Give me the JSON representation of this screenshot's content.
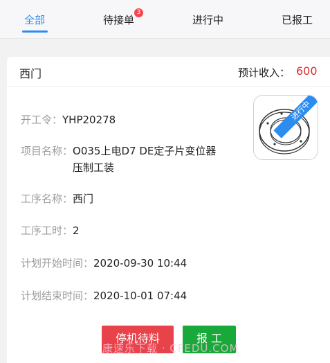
{
  "tabs": [
    {
      "label": "全部",
      "active": true
    },
    {
      "label": "待接单",
      "badge": "3"
    },
    {
      "label": "进行中"
    },
    {
      "label": "已报工"
    }
  ],
  "card": {
    "title": "西门",
    "income_label": "预计收入：",
    "income_value": "600",
    "status_ribbon": "进行中",
    "fields": [
      {
        "label": "开工令：",
        "value": "YHP20278"
      },
      {
        "label": "项目名称：",
        "value_line1": "O035上电D7 DE定子片变位器",
        "value_line2": "压制工装"
      },
      {
        "label": "工序名称：",
        "value": "西门"
      },
      {
        "label": "工序工时：",
        "value": "2"
      },
      {
        "label": "计划开始时间：",
        "value": "2020-09-30 10:44"
      },
      {
        "label": "计划结束时间：",
        "value": "2020-10-01 07:44"
      }
    ],
    "buttons": {
      "stop": "停机待料",
      "report": "报 工"
    }
  },
  "watermark": "康速乐下载 · CFEDU.COM",
  "colors": {
    "accent": "#2d8cf0",
    "price": "#e12b2b",
    "stop": "#e8434a",
    "report": "#19a83a"
  }
}
